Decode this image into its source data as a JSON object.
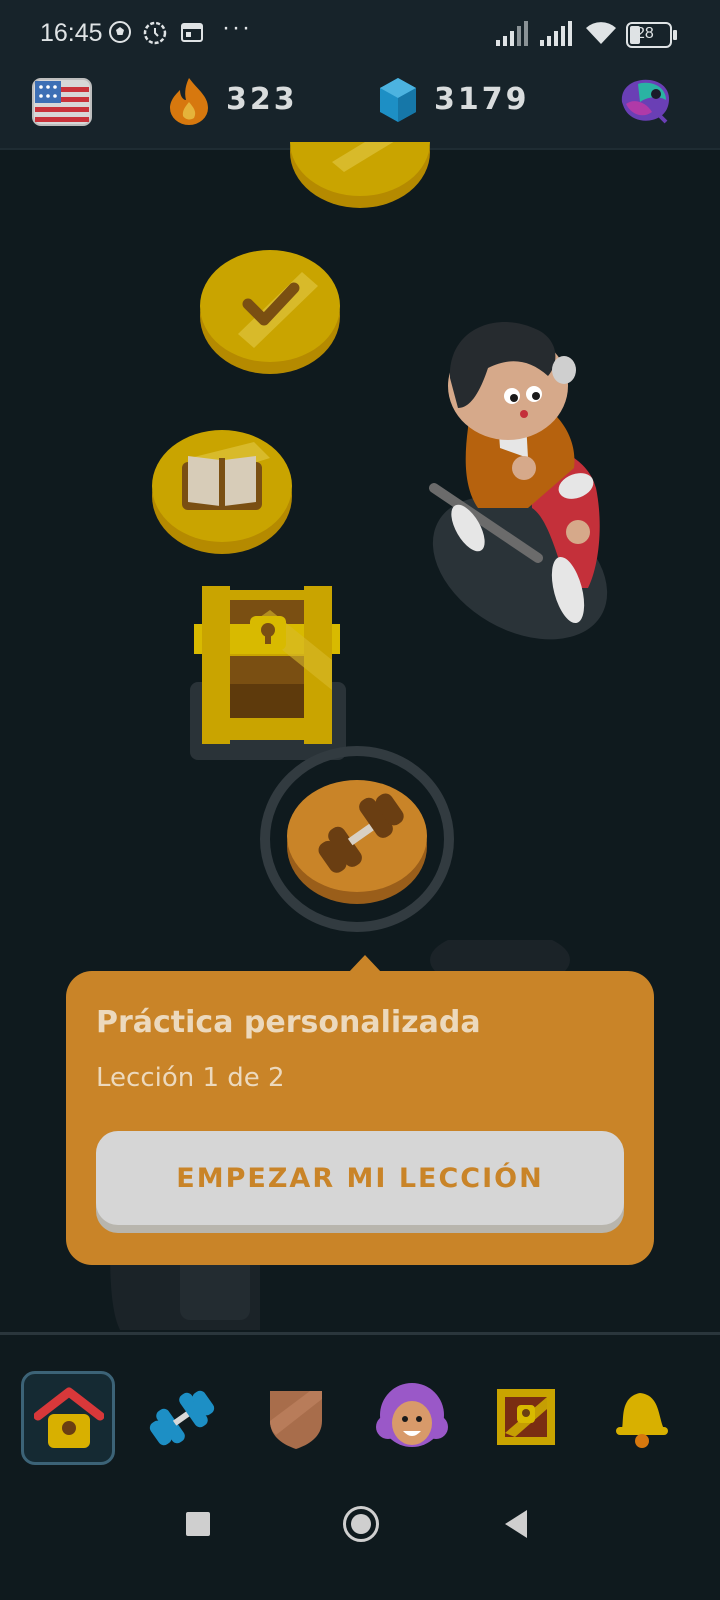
{
  "status_bar": {
    "time": "16:45",
    "more": "···",
    "battery": "28",
    "icons": [
      "soccer-ball-icon",
      "clock-gear-icon",
      "calendar-icon",
      "signal-icon",
      "signal-icon",
      "wifi-icon",
      "battery-icon"
    ]
  },
  "top_bar": {
    "course_flag": "us-flag-icon",
    "streak": "323",
    "gems": "3179",
    "profile_icon": "super-icon"
  },
  "path": {
    "nodes": [
      {
        "icon": "check-icon",
        "state": "completed"
      },
      {
        "icon": "check-icon",
        "state": "completed"
      },
      {
        "icon": "book-icon",
        "state": "completed"
      },
      {
        "icon": "treasure-chest-icon",
        "state": "opened"
      },
      {
        "icon": "dumbbell-icon",
        "state": "active"
      }
    ],
    "character": "character-on-scooter"
  },
  "tooltip": {
    "title": "Práctica personalizada",
    "subtitle": "Lección 1 de 2",
    "button_label": "EMPEZAR MI LECCIÓN"
  },
  "bottom_nav": {
    "items": [
      {
        "icon": "home-icon",
        "active": true
      },
      {
        "icon": "dumbbell-icon",
        "active": false
      },
      {
        "icon": "shield-icon",
        "active": false
      },
      {
        "icon": "character-icon",
        "active": false
      },
      {
        "icon": "chest-icon",
        "active": false
      },
      {
        "icon": "bell-icon",
        "active": false
      }
    ]
  },
  "colors": {
    "background": "#0f1a1e",
    "bar": "#17232a",
    "gold": "#c9a400",
    "accent_orange": "#c98428"
  }
}
